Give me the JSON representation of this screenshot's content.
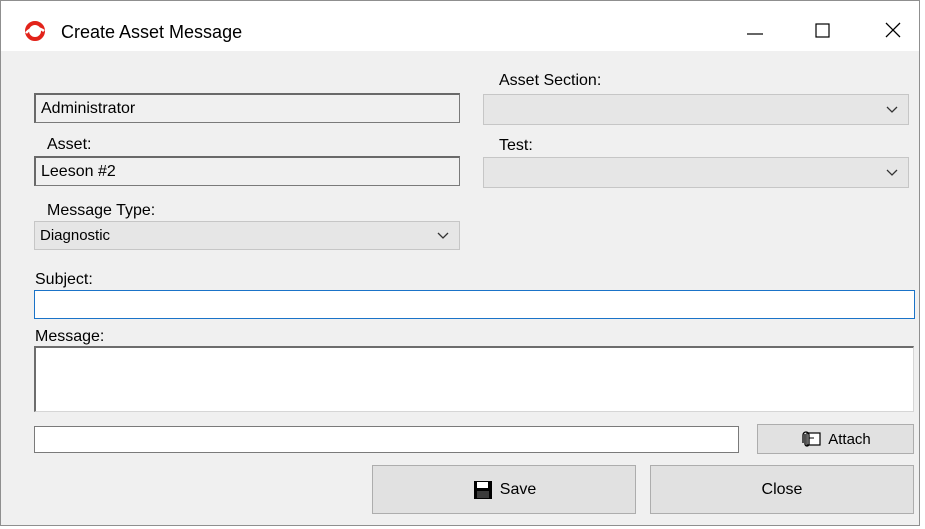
{
  "window": {
    "title": "Create Asset Message"
  },
  "form": {
    "user_value": "Administrator",
    "asset_label": "Asset:",
    "asset_value": "Leeson #2",
    "message_type_label": "Message Type:",
    "message_type_value": "Diagnostic",
    "asset_section_label": "Asset Section:",
    "asset_section_value": "",
    "test_label": "Test:",
    "test_value": "",
    "subject_label": "Subject:",
    "subject_value": "",
    "message_label": "Message:",
    "message_value": "",
    "attachment_value": ""
  },
  "buttons": {
    "attach": "Attach",
    "save": "Save",
    "close": "Close"
  },
  "icons": {
    "app": "app-logo-icon",
    "attach": "paperclip-icon",
    "save": "floppy-disk-icon"
  },
  "colors": {
    "accent": "#1a73c8",
    "logo_red": "#e2231a"
  }
}
